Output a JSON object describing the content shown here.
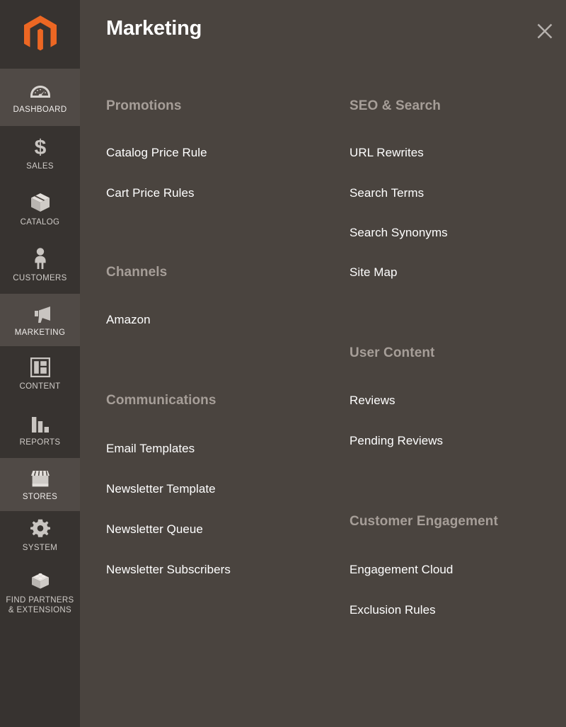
{
  "brand": {
    "logo_icon": "magento-logo-icon",
    "logo_color": "#ec6723"
  },
  "theme": {
    "sidebar_bg": "#373330",
    "sidebar_active_bg": "#504a46",
    "panel_bg": "#4a443f",
    "heading_color": "#a69e98",
    "link_color": "#ffffff"
  },
  "sidebar": {
    "items": [
      {
        "id": "dashboard",
        "label": "DASHBOARD",
        "icon": "gauge-icon",
        "state": "active"
      },
      {
        "id": "sales",
        "label": "SALES",
        "icon": "dollar-icon",
        "state": "default"
      },
      {
        "id": "catalog",
        "label": "CATALOG",
        "icon": "box-icon",
        "state": "default"
      },
      {
        "id": "customers",
        "label": "CUSTOMERS",
        "icon": "person-icon",
        "state": "default"
      },
      {
        "id": "marketing",
        "label": "MARKETING",
        "icon": "megaphone-icon",
        "state": "active"
      },
      {
        "id": "content",
        "label": "CONTENT",
        "icon": "layout-icon",
        "state": "default"
      },
      {
        "id": "reports",
        "label": "REPORTS",
        "icon": "bar-chart-icon",
        "state": "default"
      },
      {
        "id": "stores",
        "label": "STORES",
        "icon": "storefront-icon",
        "state": "active"
      },
      {
        "id": "system",
        "label": "SYSTEM",
        "icon": "gear-icon",
        "state": "default"
      },
      {
        "id": "find-partners",
        "label": "FIND PARTNERS\n& EXTENSIONS",
        "icon": "brick-icon",
        "state": "default"
      }
    ]
  },
  "panel": {
    "title": "Marketing",
    "close_icon": "close-icon",
    "columns": [
      {
        "id": "left",
        "groups": [
          {
            "title": "Promotions",
            "items": [
              {
                "label": "Catalog Price Rule"
              },
              {
                "label": "Cart Price Rules"
              }
            ]
          },
          {
            "title": "Channels",
            "items": [
              {
                "label": "Amazon"
              }
            ]
          },
          {
            "title": "Communications",
            "items": [
              {
                "label": "Email Templates"
              },
              {
                "label": "Newsletter Template"
              },
              {
                "label": "Newsletter Queue"
              },
              {
                "label": "Newsletter Subscribers"
              }
            ]
          }
        ]
      },
      {
        "id": "right",
        "groups": [
          {
            "title": "SEO & Search",
            "items": [
              {
                "label": "URL Rewrites"
              },
              {
                "label": "Search Terms"
              },
              {
                "label": "Search Synonyms"
              },
              {
                "label": "Site Map"
              }
            ]
          },
          {
            "title": "User Content",
            "items": [
              {
                "label": "Reviews"
              },
              {
                "label": "Pending Reviews"
              }
            ]
          },
          {
            "title": "Customer Engagement",
            "items": [
              {
                "label": "Engagement Cloud"
              },
              {
                "label": "Exclusion Rules"
              }
            ]
          }
        ]
      }
    ]
  }
}
